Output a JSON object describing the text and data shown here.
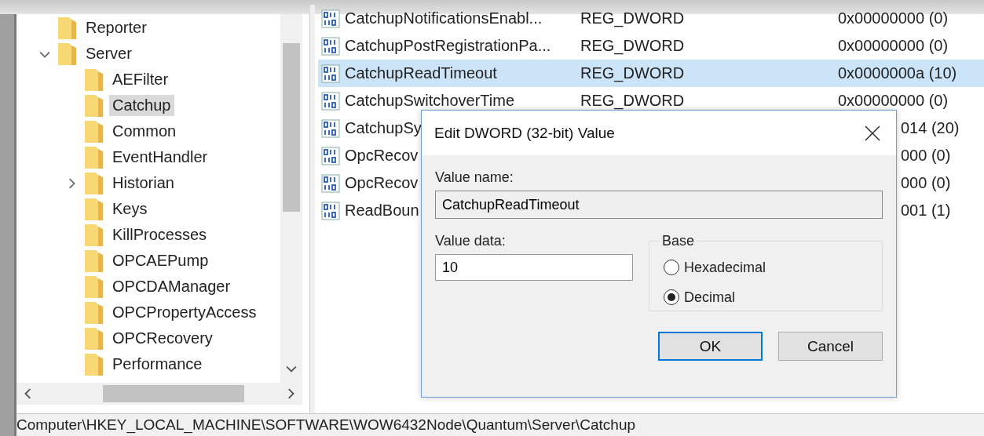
{
  "tree": {
    "items": [
      {
        "label": "Reporter",
        "selected": false
      },
      {
        "label": "Server",
        "selected": false,
        "expanded": true,
        "children": [
          {
            "label": "AEFilter",
            "selected": false
          },
          {
            "label": "Catchup",
            "selected": true
          },
          {
            "label": "Common",
            "selected": false
          },
          {
            "label": "EventHandler",
            "selected": false
          },
          {
            "label": "Historian",
            "selected": false,
            "expanded": false
          },
          {
            "label": "Keys",
            "selected": false
          },
          {
            "label": "KillProcesses",
            "selected": false
          },
          {
            "label": "OPCAEPump",
            "selected": false
          },
          {
            "label": "OPCDAManager",
            "selected": false
          },
          {
            "label": "OPCPropertyAccess",
            "selected": false
          },
          {
            "label": "OPCRecovery",
            "selected": false
          },
          {
            "label": "Performance",
            "selected": false
          }
        ]
      }
    ]
  },
  "values": {
    "rows": [
      {
        "kind": "full",
        "name": "CatchupNotificationsEnabl...",
        "type": "REG_DWORD",
        "data": "0x00000000 (0)",
        "selected": false
      },
      {
        "kind": "full",
        "name": "CatchupPostRegistrationPa...",
        "type": "REG_DWORD",
        "data": "0x00000000 (0)",
        "selected": false
      },
      {
        "kind": "full",
        "name": "CatchupReadTimeout",
        "type": "REG_DWORD",
        "data": "0x0000000a (10)",
        "selected": true
      },
      {
        "kind": "full",
        "name": "CatchupSwitchoverTime",
        "type": "REG_DWORD",
        "data": "0x00000000 (0)",
        "selected": false
      },
      {
        "kind": "covered",
        "name": "CatchupSy",
        "data": "014 (20)",
        "selected": false
      },
      {
        "kind": "covered",
        "name": "OpcRecov",
        "data": "000 (0)",
        "selected": false
      },
      {
        "kind": "covered",
        "name": "OpcRecov",
        "data": "000 (0)",
        "selected": false
      },
      {
        "kind": "covered",
        "name": "ReadBoun",
        "data": "001 (1)",
        "selected": false
      }
    ]
  },
  "dialog": {
    "title": "Edit DWORD (32-bit) Value",
    "value_name_label": "Value name:",
    "value_name": "CatchupReadTimeout",
    "value_data_label": "Value data:",
    "value_data": "10",
    "base_label": "Base",
    "bases": [
      {
        "label": "Hexadecimal",
        "selected": false
      },
      {
        "label": "Decimal",
        "selected": true
      }
    ],
    "buttons": [
      {
        "label": "OK",
        "default": true
      },
      {
        "label": "Cancel",
        "default": false
      }
    ]
  },
  "status_bar": "Computer\\HKEY_LOCAL_MACHINE\\SOFTWARE\\WOW6432Node\\Quantum\\Server\\Catchup"
}
